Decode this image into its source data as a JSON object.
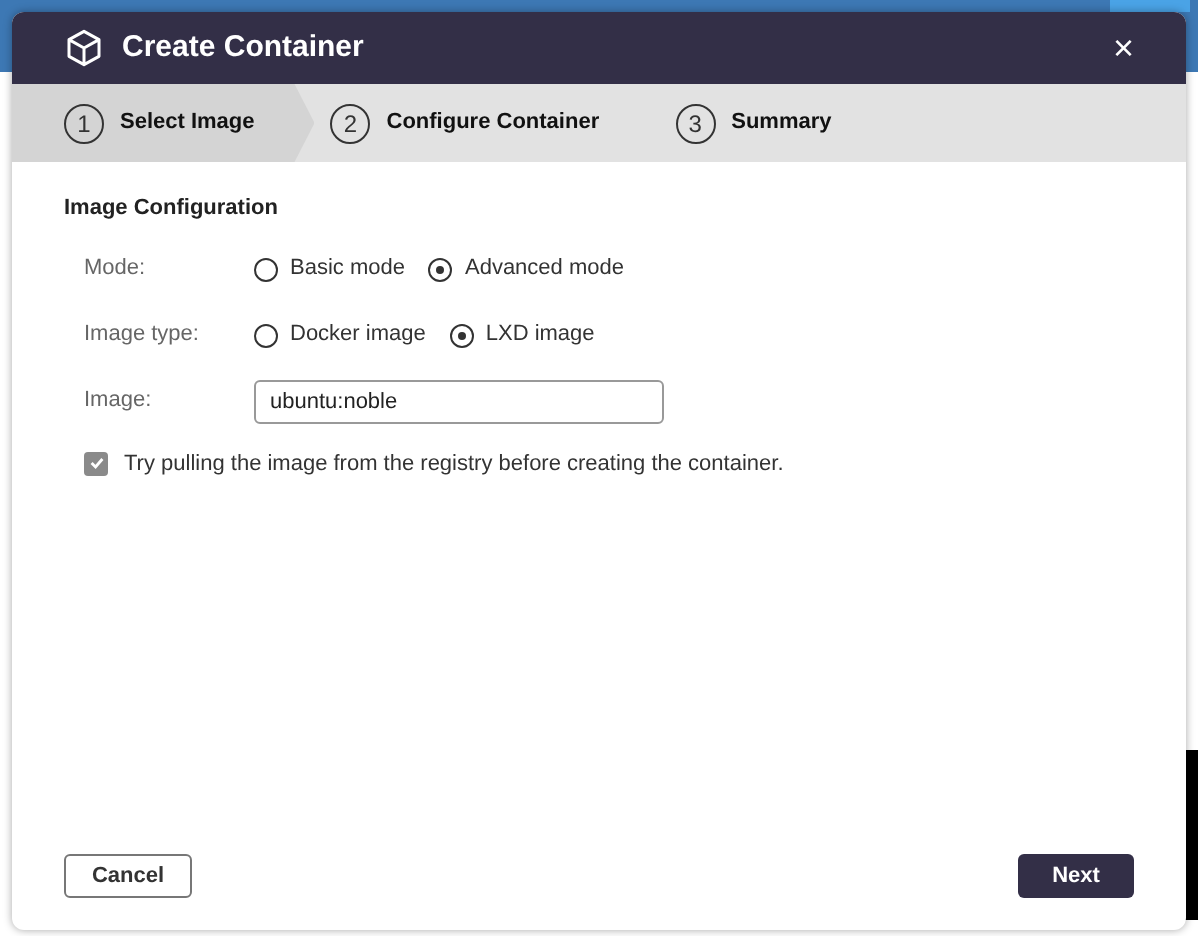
{
  "dialog": {
    "title": "Create Container",
    "close": "×"
  },
  "steps": [
    {
      "number": "1",
      "label": "Select Image",
      "selected": true
    },
    {
      "number": "2",
      "label": "Configure Container",
      "selected": false
    },
    {
      "number": "3",
      "label": "Summary",
      "selected": false
    }
  ],
  "section_title": "Image Configuration",
  "fields": [
    {
      "kind": "radio",
      "label": "Mode:",
      "options": [
        {
          "label": "Basic mode",
          "selected": false
        },
        {
          "label": "Advanced mode",
          "selected": true
        }
      ]
    },
    {
      "kind": "radio",
      "label": "Image type:",
      "options": [
        {
          "label": "Docker image",
          "selected": false
        },
        {
          "label": "LXD image",
          "selected": true
        }
      ]
    },
    {
      "kind": "text",
      "label": "Image:",
      "value": "ubuntu:noble"
    }
  ],
  "pull_option": {
    "label": "Try pulling the image from the registry before creating the container.",
    "checked": true
  },
  "buttons": {
    "cancel": "Cancel",
    "next": "Next"
  }
}
